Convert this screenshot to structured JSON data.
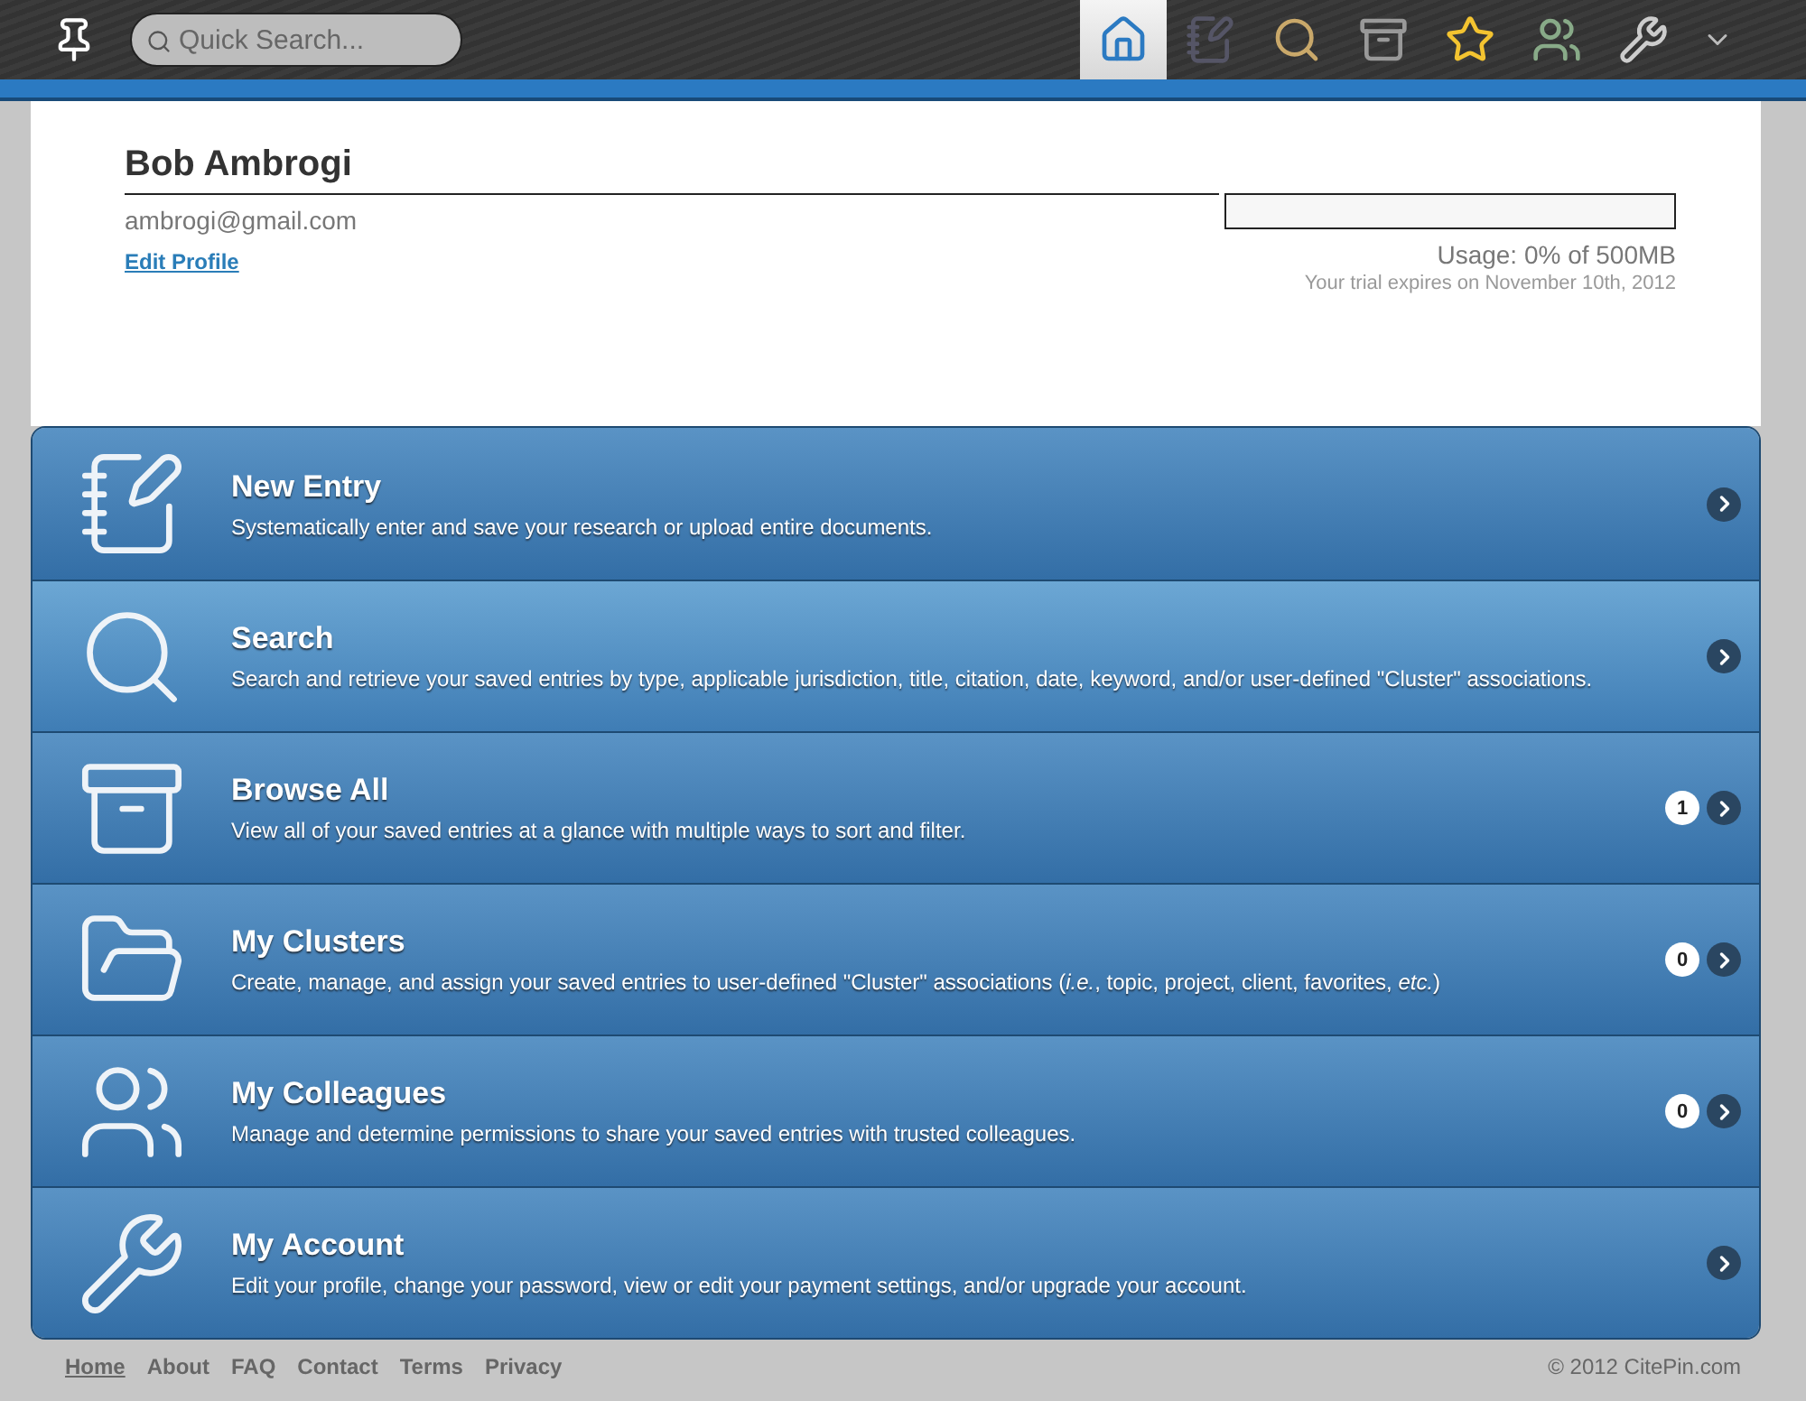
{
  "topbar": {
    "search": {
      "placeholder": "Quick Search..."
    },
    "nav": [
      {
        "selected": true
      },
      {
        "selected": false
      },
      {
        "selected": false
      },
      {
        "selected": false
      },
      {
        "selected": false
      },
      {
        "selected": false
      },
      {
        "selected": false
      }
    ]
  },
  "profile": {
    "name": "Bob Ambrogi",
    "email": "ambrogi@gmail.com",
    "edit_link": "Edit Profile",
    "usage": {
      "level": 0,
      "reading": "Usage: 0% of 500MB",
      "trial": "Your trial expires on November 10th, 2012"
    }
  },
  "menu": [
    {
      "title": "New Entry",
      "description": "Systematically enter and save your research or upload entire documents.",
      "selected": false
    },
    {
      "title": "Search",
      "description": "Search and retrieve your saved entries by type, applicable jurisdiction, title, citation, date, keyword, and/or user-defined \"Cluster\" associations.",
      "selected": true
    },
    {
      "title": "Browse All",
      "description": "View all of your saved entries at a glance with multiple ways to sort and filter.",
      "count": "1",
      "selected": false
    },
    {
      "title": "My Clusters",
      "description": "Create, manage, and assign your saved entries to user-defined \"Cluster\" associations (*i.e.*, topic, project, client, favorites, *etc.*)",
      "count": "0",
      "selected": false
    },
    {
      "title": "My Colleagues",
      "description": "Manage and determine permissions to share your saved entries with trusted colleagues.",
      "count": "0",
      "selected": false
    },
    {
      "title": "My Account",
      "description": "Edit your profile, change your password, view or edit your payment settings, and/or upgrade your account.",
      "selected": false
    }
  ],
  "footer": {
    "links": [
      {
        "label": "Home",
        "selected": true
      },
      {
        "label": "About",
        "selected": false
      },
      {
        "label": "FAQ",
        "selected": false
      },
      {
        "label": "Contact",
        "selected": false
      },
      {
        "label": "Terms",
        "selected": false
      },
      {
        "label": "Privacy",
        "selected": false
      }
    ],
    "copyright": "© 2012 CitePin.com"
  }
}
